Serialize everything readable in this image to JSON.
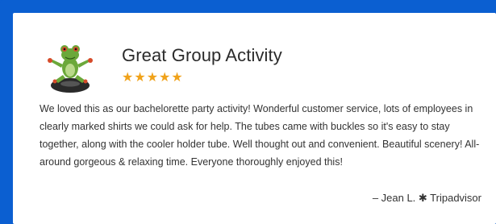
{
  "review_card": {
    "title": "Great Group Activity",
    "stars": "★★★★★",
    "rating": 5,
    "rating_max": 5,
    "body": "We loved this as our bachelorette party activity! Wonderful customer service, lots of employees in clearly marked shirts we could ask for help. The tubes came with buckles so it's easy to stay together, along with the cooler holder tube. Well thought out and convenient. Beautiful scenery! All-around gorgeous & relaxing time. Everyone thoroughly enjoyed this!",
    "attribution": "– Jean L. ✱ Tripadvisor",
    "mascot_icon": "frog-on-tube-icon"
  },
  "colors": {
    "border": "#0b5fd1",
    "star": "#f0a21a",
    "text": "#333333"
  }
}
